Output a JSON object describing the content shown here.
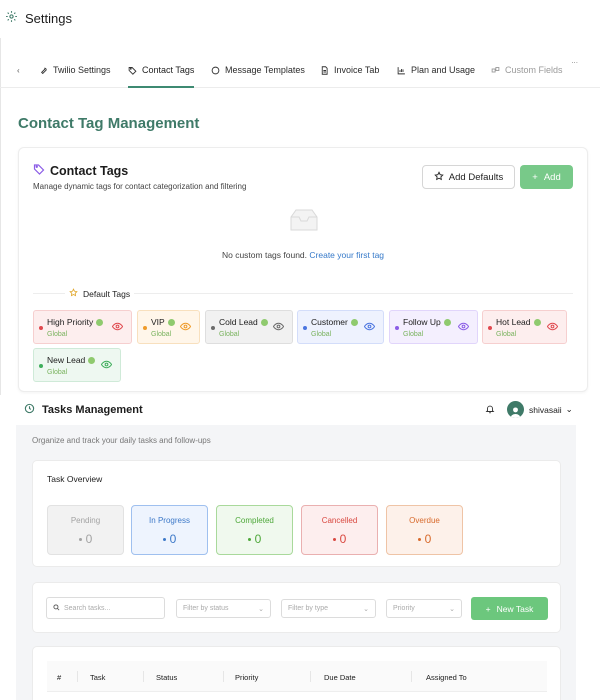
{
  "settings": {
    "title": "Settings",
    "tabs": [
      {
        "label": "Twilio Settings",
        "icon": "wrench-icon"
      },
      {
        "label": "Contact Tags",
        "icon": "tag-icon",
        "active": true
      },
      {
        "label": "Message Templates",
        "icon": "message-circle-icon"
      },
      {
        "label": "Invoice Tab",
        "icon": "document-icon"
      },
      {
        "label": "Plan and Usage",
        "icon": "bar-chart-icon"
      },
      {
        "label": "Custom Fields",
        "icon": "fields-icon"
      }
    ],
    "more": "..."
  },
  "contact_tags": {
    "page_title": "Contact Tag Management",
    "card_title": "Contact Tags",
    "card_subtitle": "Manage dynamic tags for contact categorization and filtering",
    "add_defaults_label": "Add Defaults",
    "add_label": "Add",
    "empty_text": "No custom tags found.",
    "empty_link": "Create your first tag",
    "default_tags_label": "Default Tags",
    "tags": [
      {
        "name": "High Priority",
        "scope": "Global",
        "dot": "#e0484e",
        "bg": "#fdeeee",
        "border": "#f6cfcf",
        "eye": "#e0484e"
      },
      {
        "name": "VIP",
        "scope": "Global",
        "dot": "#ef9b2a",
        "bg": "#fff6ea",
        "border": "#f8e0be",
        "eye": "#ef9b2a"
      },
      {
        "name": "Cold Lead",
        "scope": "Global",
        "dot": "#6b6b6b",
        "bg": "#f1f1f1",
        "border": "#dedede",
        "eye": "#6b6b6b"
      },
      {
        "name": "Customer",
        "scope": "Global",
        "dot": "#4b75e0",
        "bg": "#eef2fe",
        "border": "#d3ddfa",
        "eye": "#4b75e0"
      },
      {
        "name": "Follow Up",
        "scope": "Global",
        "dot": "#8b5ce6",
        "bg": "#f4effe",
        "border": "#e1d5fb",
        "eye": "#8b5ce6"
      },
      {
        "name": "Hot Lead",
        "scope": "Global",
        "dot": "#e0484e",
        "bg": "#fdeeee",
        "border": "#f6cfcf",
        "eye": "#e0484e"
      },
      {
        "name": "New Lead",
        "scope": "Global",
        "dot": "#3fae5c",
        "bg": "#eef8f1",
        "border": "#cfead8",
        "eye": "#3fae5c"
      }
    ]
  },
  "tasks": {
    "title": "Tasks Management",
    "username": "shivasaii",
    "subtitle": "Organize and track your daily tasks and follow-ups",
    "overview_title": "Task Overview",
    "stats": [
      {
        "label": "Pending",
        "value": "0",
        "bg": "#f2f2f2",
        "border": "#e2e2e2",
        "color": "#a3a3a3"
      },
      {
        "label": "In Progress",
        "value": "0",
        "bg": "#eef4fe",
        "border": "#9fc0ef",
        "color": "#3c78c8"
      },
      {
        "label": "Completed",
        "value": "0",
        "bg": "#f0f9ee",
        "border": "#a9d99b",
        "color": "#4ea83a"
      },
      {
        "label": "Cancelled",
        "value": "0",
        "bg": "#fdeeee",
        "border": "#eab0b0",
        "color": "#d9473f"
      },
      {
        "label": "Overdue",
        "value": "0",
        "bg": "#fdf1ea",
        "border": "#efc4a6",
        "color": "#d86a2c"
      }
    ],
    "search_placeholder": "Search tasks...",
    "filters": [
      "Filter by status",
      "Filter by type",
      "Priority"
    ],
    "new_task_label": "New Task",
    "columns": [
      "#",
      "Task",
      "Status",
      "Priority",
      "Due Date",
      "Assigned To"
    ]
  }
}
